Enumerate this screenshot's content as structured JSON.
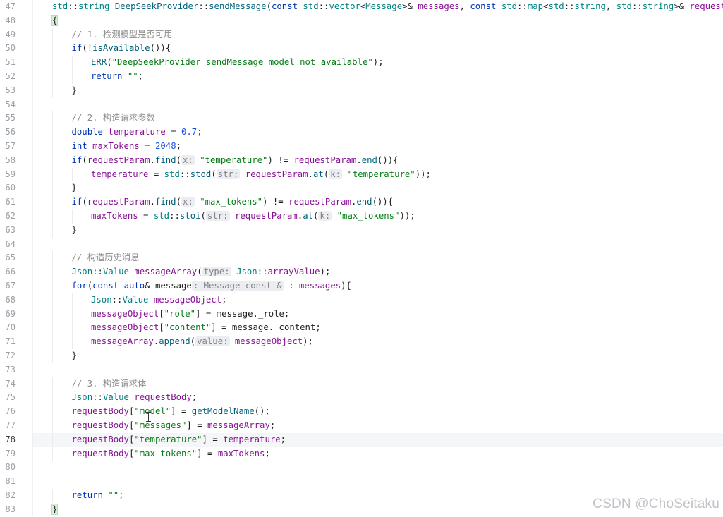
{
  "watermark": "CSDN @ChoSeitaku",
  "current_line": 78,
  "colors": {
    "keyword": "#0033b3",
    "type": "#008080",
    "func": "#00627a",
    "var": "#871094",
    "string": "#067d17",
    "number": "#1750eb",
    "comment": "#8c8c8c",
    "hint_bg": "#ebedf0",
    "hint_fg": "#7f8287",
    "plain": "#1f1f1f",
    "brace_match_bg": "#d9f0dd"
  },
  "lines": [
    {
      "n": "47",
      "indent": 0,
      "tokens": [
        [
          "type",
          "std"
        ],
        [
          "plain",
          "::"
        ],
        [
          "type",
          "string"
        ],
        [
          "plain",
          " "
        ],
        [
          "func",
          "DeepSeekProvider"
        ],
        [
          "plain",
          "::"
        ],
        [
          "func",
          "sendMessage"
        ],
        [
          "plain",
          "("
        ],
        [
          "keyword",
          "const"
        ],
        [
          "plain",
          " "
        ],
        [
          "type",
          "std"
        ],
        [
          "plain",
          "::"
        ],
        [
          "type",
          "vector"
        ],
        [
          "plain",
          "<"
        ],
        [
          "type",
          "Message"
        ],
        [
          "plain",
          ">& "
        ],
        [
          "var",
          "messages"
        ],
        [
          "plain",
          ", "
        ],
        [
          "keyword",
          "const"
        ],
        [
          "plain",
          " "
        ],
        [
          "type",
          "std"
        ],
        [
          "plain",
          "::"
        ],
        [
          "type",
          "map"
        ],
        [
          "plain",
          "<"
        ],
        [
          "type",
          "std"
        ],
        [
          "plain",
          "::"
        ],
        [
          "type",
          "string"
        ],
        [
          "plain",
          ", "
        ],
        [
          "type",
          "std"
        ],
        [
          "plain",
          "::"
        ],
        [
          "type",
          "string"
        ],
        [
          "plain",
          ">& "
        ],
        [
          "var",
          "requestParam"
        ],
        [
          "plain",
          ")"
        ]
      ]
    },
    {
      "n": "48",
      "indent": 0,
      "tokens": [
        [
          "brace",
          "{"
        ]
      ]
    },
    {
      "n": "49",
      "indent": 1,
      "tokens": [
        [
          "comment",
          "// 1. 检测模型是否可用"
        ]
      ]
    },
    {
      "n": "50",
      "indent": 1,
      "tokens": [
        [
          "keyword",
          "if"
        ],
        [
          "plain",
          "(!"
        ],
        [
          "func",
          "isAvailable"
        ],
        [
          "plain",
          "()){"
        ]
      ]
    },
    {
      "n": "51",
      "indent": 2,
      "tokens": [
        [
          "func",
          "ERR"
        ],
        [
          "plain",
          "("
        ],
        [
          "string",
          "\"DeepSeekProvider sendMessage model not available\""
        ],
        [
          "plain",
          ");"
        ]
      ]
    },
    {
      "n": "52",
      "indent": 2,
      "tokens": [
        [
          "keyword",
          "return"
        ],
        [
          "plain",
          " "
        ],
        [
          "string",
          "\"\""
        ],
        [
          "plain",
          ";"
        ]
      ]
    },
    {
      "n": "53",
      "indent": 1,
      "tokens": [
        [
          "plain",
          "}"
        ]
      ]
    },
    {
      "n": "54",
      "indent": 0,
      "tokens": []
    },
    {
      "n": "55",
      "indent": 1,
      "tokens": [
        [
          "comment",
          "// 2. 构造请求参数"
        ]
      ]
    },
    {
      "n": "56",
      "indent": 1,
      "tokens": [
        [
          "keyword",
          "double"
        ],
        [
          "plain",
          " "
        ],
        [
          "var",
          "temperature"
        ],
        [
          "plain",
          " = "
        ],
        [
          "number",
          "0.7"
        ],
        [
          "plain",
          ";"
        ]
      ]
    },
    {
      "n": "57",
      "indent": 1,
      "tokens": [
        [
          "keyword",
          "int"
        ],
        [
          "plain",
          " "
        ],
        [
          "var",
          "maxTokens"
        ],
        [
          "plain",
          " = "
        ],
        [
          "number",
          "2048"
        ],
        [
          "plain",
          ";"
        ]
      ]
    },
    {
      "n": "58",
      "indent": 1,
      "tokens": [
        [
          "keyword",
          "if"
        ],
        [
          "plain",
          "("
        ],
        [
          "var",
          "requestParam"
        ],
        [
          "plain",
          "."
        ],
        [
          "func",
          "find"
        ],
        [
          "plain",
          "("
        ],
        [
          "hint",
          "x:"
        ],
        [
          "plain",
          " "
        ],
        [
          "string",
          "\"temperature\""
        ],
        [
          "plain",
          ") != "
        ],
        [
          "var",
          "requestParam"
        ],
        [
          "plain",
          "."
        ],
        [
          "func",
          "end"
        ],
        [
          "plain",
          "()){"
        ]
      ]
    },
    {
      "n": "59",
      "indent": 2,
      "tokens": [
        [
          "var",
          "temperature"
        ],
        [
          "plain",
          " = "
        ],
        [
          "type",
          "std"
        ],
        [
          "plain",
          "::"
        ],
        [
          "func",
          "stod"
        ],
        [
          "plain",
          "("
        ],
        [
          "hint",
          "str:"
        ],
        [
          "plain",
          " "
        ],
        [
          "var",
          "requestParam"
        ],
        [
          "plain",
          "."
        ],
        [
          "func",
          "at"
        ],
        [
          "plain",
          "("
        ],
        [
          "hint",
          "k:"
        ],
        [
          "plain",
          " "
        ],
        [
          "string",
          "\"temperature\""
        ],
        [
          "plain",
          "));"
        ]
      ]
    },
    {
      "n": "60",
      "indent": 1,
      "tokens": [
        [
          "plain",
          "}"
        ]
      ]
    },
    {
      "n": "61",
      "indent": 1,
      "tokens": [
        [
          "keyword",
          "if"
        ],
        [
          "plain",
          "("
        ],
        [
          "var",
          "requestParam"
        ],
        [
          "plain",
          "."
        ],
        [
          "func",
          "find"
        ],
        [
          "plain",
          "("
        ],
        [
          "hint",
          "x:"
        ],
        [
          "plain",
          " "
        ],
        [
          "string",
          "\"max_tokens\""
        ],
        [
          "plain",
          ") != "
        ],
        [
          "var",
          "requestParam"
        ],
        [
          "plain",
          "."
        ],
        [
          "func",
          "end"
        ],
        [
          "plain",
          "()){"
        ]
      ]
    },
    {
      "n": "62",
      "indent": 2,
      "tokens": [
        [
          "var",
          "maxTokens"
        ],
        [
          "plain",
          " = "
        ],
        [
          "type",
          "std"
        ],
        [
          "plain",
          "::"
        ],
        [
          "func",
          "stoi"
        ],
        [
          "plain",
          "("
        ],
        [
          "hint",
          "str:"
        ],
        [
          "plain",
          " "
        ],
        [
          "var",
          "requestParam"
        ],
        [
          "plain",
          "."
        ],
        [
          "func",
          "at"
        ],
        [
          "plain",
          "("
        ],
        [
          "hint",
          "k:"
        ],
        [
          "plain",
          " "
        ],
        [
          "string",
          "\"max_tokens\""
        ],
        [
          "plain",
          "));"
        ]
      ]
    },
    {
      "n": "63",
      "indent": 1,
      "tokens": [
        [
          "plain",
          "}"
        ]
      ]
    },
    {
      "n": "64",
      "indent": 0,
      "tokens": []
    },
    {
      "n": "65",
      "indent": 1,
      "tokens": [
        [
          "comment",
          "// 构造历史消息"
        ]
      ]
    },
    {
      "n": "66",
      "indent": 1,
      "tokens": [
        [
          "type",
          "Json"
        ],
        [
          "plain",
          "::"
        ],
        [
          "type",
          "Value"
        ],
        [
          "plain",
          " "
        ],
        [
          "var",
          "messageArray"
        ],
        [
          "plain",
          "("
        ],
        [
          "hint",
          "type:"
        ],
        [
          "plain",
          " "
        ],
        [
          "type",
          "Json"
        ],
        [
          "plain",
          "::"
        ],
        [
          "var",
          "arrayValue"
        ],
        [
          "plain",
          ");"
        ]
      ]
    },
    {
      "n": "67",
      "indent": 1,
      "tokens": [
        [
          "keyword",
          "for"
        ],
        [
          "plain",
          "("
        ],
        [
          "keyword",
          "const"
        ],
        [
          "plain",
          " "
        ],
        [
          "keyword",
          "auto"
        ],
        [
          "plain",
          "& "
        ],
        [
          "plain",
          "message"
        ],
        [
          "hint",
          ": Message const &"
        ],
        [
          "plain",
          " : "
        ],
        [
          "var",
          "messages"
        ],
        [
          "plain",
          "){"
        ]
      ]
    },
    {
      "n": "68",
      "indent": 2,
      "tokens": [
        [
          "type",
          "Json"
        ],
        [
          "plain",
          "::"
        ],
        [
          "type",
          "Value"
        ],
        [
          "plain",
          " "
        ],
        [
          "var",
          "messageObject"
        ],
        [
          "plain",
          ";"
        ]
      ]
    },
    {
      "n": "69",
      "indent": 2,
      "tokens": [
        [
          "var",
          "messageObject"
        ],
        [
          "plain",
          "["
        ],
        [
          "string",
          "\"role\""
        ],
        [
          "plain",
          "] = message._role;"
        ]
      ]
    },
    {
      "n": "70",
      "indent": 2,
      "tokens": [
        [
          "var",
          "messageObject"
        ],
        [
          "plain",
          "["
        ],
        [
          "string",
          "\"content\""
        ],
        [
          "plain",
          "] = message._content;"
        ]
      ]
    },
    {
      "n": "71",
      "indent": 2,
      "tokens": [
        [
          "var",
          "messageArray"
        ],
        [
          "plain",
          "."
        ],
        [
          "func",
          "append"
        ],
        [
          "plain",
          "("
        ],
        [
          "hint",
          "value:"
        ],
        [
          "plain",
          " "
        ],
        [
          "var",
          "messageObject"
        ],
        [
          "plain",
          ");"
        ]
      ]
    },
    {
      "n": "72",
      "indent": 1,
      "tokens": [
        [
          "plain",
          "}"
        ]
      ]
    },
    {
      "n": "73",
      "indent": 0,
      "tokens": []
    },
    {
      "n": "74",
      "indent": 1,
      "tokens": [
        [
          "comment",
          "// 3. 构造请求体"
        ]
      ]
    },
    {
      "n": "75",
      "indent": 1,
      "tokens": [
        [
          "type",
          "Json"
        ],
        [
          "plain",
          "::"
        ],
        [
          "type",
          "Value"
        ],
        [
          "plain",
          " "
        ],
        [
          "var",
          "requestBody"
        ],
        [
          "plain",
          ";"
        ]
      ]
    },
    {
      "n": "76",
      "indent": 1,
      "tokens": [
        [
          "var",
          "requestBody"
        ],
        [
          "plain",
          "["
        ],
        [
          "string",
          "\"model\""
        ],
        [
          "plain",
          "] = "
        ],
        [
          "func",
          "getModelName"
        ],
        [
          "plain",
          "();"
        ]
      ]
    },
    {
      "n": "77",
      "indent": 1,
      "tokens": [
        [
          "var",
          "requestBody"
        ],
        [
          "plain",
          "["
        ],
        [
          "string",
          "\"messages\""
        ],
        [
          "plain",
          "] = "
        ],
        [
          "var",
          "messageArray"
        ],
        [
          "plain",
          ";"
        ]
      ]
    },
    {
      "n": "78",
      "indent": 1,
      "tokens": [
        [
          "var",
          "requestBody"
        ],
        [
          "plain",
          "["
        ],
        [
          "string",
          "\"temperature\""
        ],
        [
          "plain",
          "] = "
        ],
        [
          "var",
          "temperature"
        ],
        [
          "plain",
          ";"
        ]
      ]
    },
    {
      "n": "79",
      "indent": 1,
      "tokens": [
        [
          "var",
          "requestBody"
        ],
        [
          "plain",
          "["
        ],
        [
          "string",
          "\"max_tokens\""
        ],
        [
          "plain",
          "] = "
        ],
        [
          "var",
          "maxTokens"
        ],
        [
          "plain",
          ";"
        ]
      ]
    },
    {
      "n": "80",
      "indent": 0,
      "tokens": []
    },
    {
      "n": "81",
      "indent": 0,
      "tokens": []
    },
    {
      "n": "82",
      "indent": 1,
      "tokens": [
        [
          "keyword",
          "return"
        ],
        [
          "plain",
          " "
        ],
        [
          "string",
          "\"\""
        ],
        [
          "plain",
          ";"
        ]
      ]
    },
    {
      "n": "83",
      "indent": 0,
      "tokens": [
        [
          "brace",
          "}"
        ]
      ]
    }
  ]
}
